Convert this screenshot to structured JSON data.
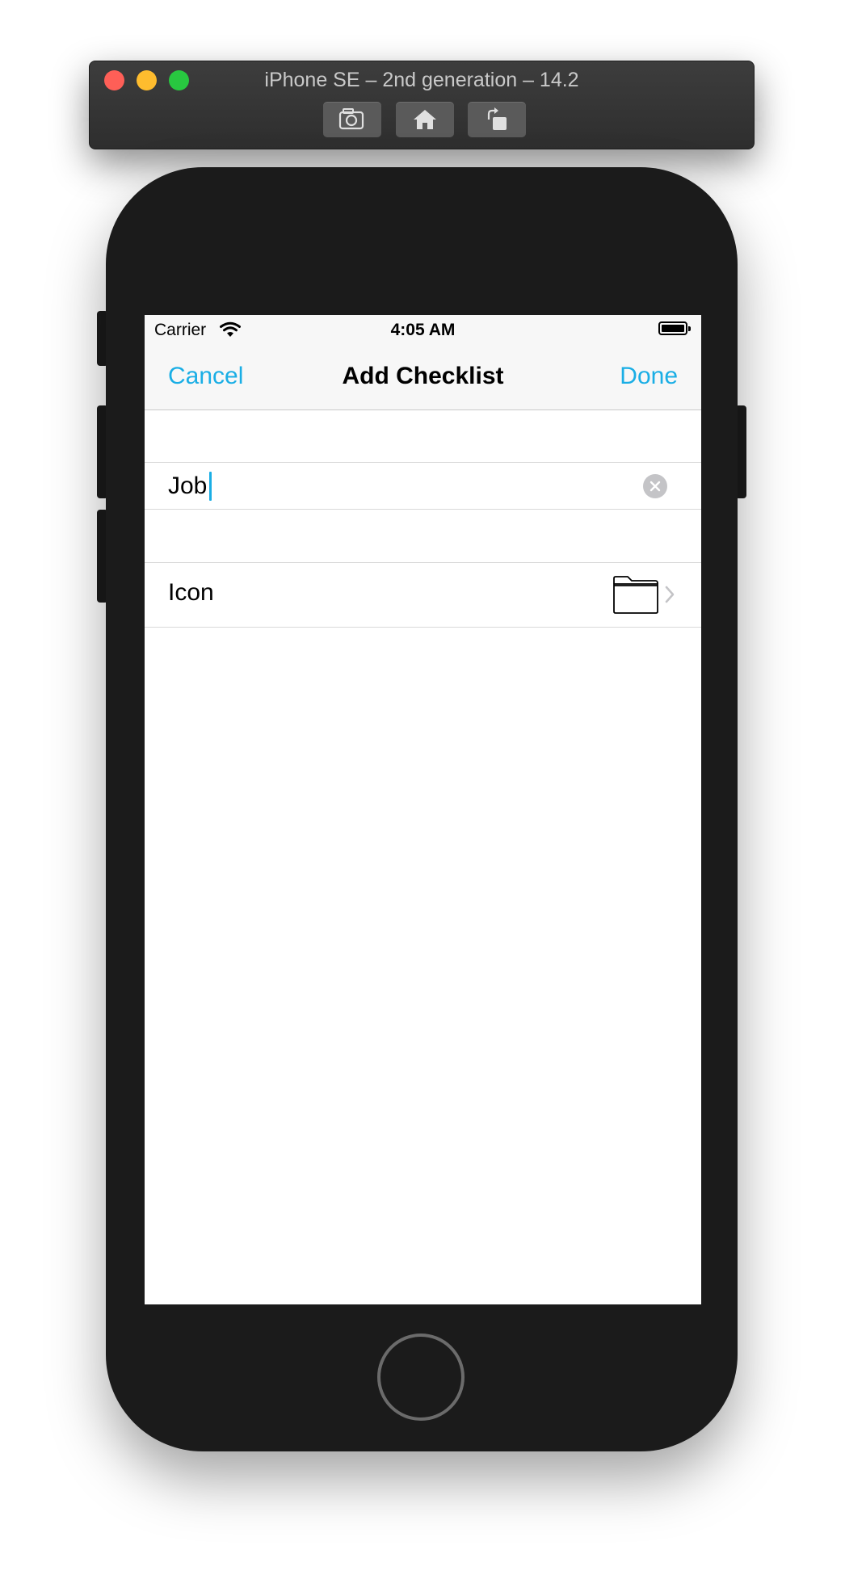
{
  "simulator": {
    "title": "iPhone SE – 2nd generation – 14.2",
    "buttons": {
      "screenshot_icon": "camera-icon",
      "home_icon": "home-icon",
      "rotate_icon": "rotate-icon"
    },
    "traffic_colors": {
      "close": "#fe5f57",
      "minimize": "#febc2e",
      "zoom": "#28c840"
    }
  },
  "status_bar": {
    "carrier": "Carrier",
    "time": "4:05 AM",
    "wifi_icon": "wifi-icon",
    "battery_icon": "battery-icon"
  },
  "nav": {
    "cancel_label": "Cancel",
    "title": "Add Checklist",
    "done_label": "Done",
    "accent_color": "#1aaee5"
  },
  "form": {
    "name_value": "Job",
    "clear_icon": "clear-icon",
    "icon_row_label": "Icon",
    "icon_value": "folder-icon",
    "disclosure_icon": "chevron-right-icon"
  }
}
